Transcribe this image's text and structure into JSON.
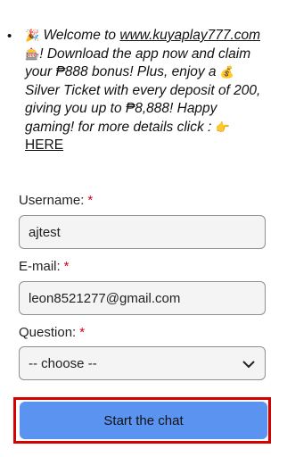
{
  "welcome": {
    "party_emoji": "🎉",
    "line_before_link": "Welcome to",
    "link_text": "www.kuyaplay777.com",
    "ticket_emoji": "🎰",
    "exclaim": "!",
    "body": "Download the app now and claim your ₱888 bonus!  Plus, enjoy a",
    "bag_emoji": "💰",
    "body2": "Silver Ticket with every deposit of 200, giving you up to ₱8,888!  Happy gaming!  for more details click :",
    "point_emoji": "👉",
    "here_link": "HERE"
  },
  "form": {
    "username_label": "Username:",
    "username_value": "ajtest",
    "email_label": "E-mail:",
    "email_value": "leon8521277@gmail.com",
    "question_label": "Question:",
    "question_selected": "-- choose --",
    "required_mark": "*",
    "submit_label": "Start the chat"
  },
  "colors": {
    "accent": "#5b93f0",
    "highlight": "#d60000",
    "required": "#d0021b"
  }
}
